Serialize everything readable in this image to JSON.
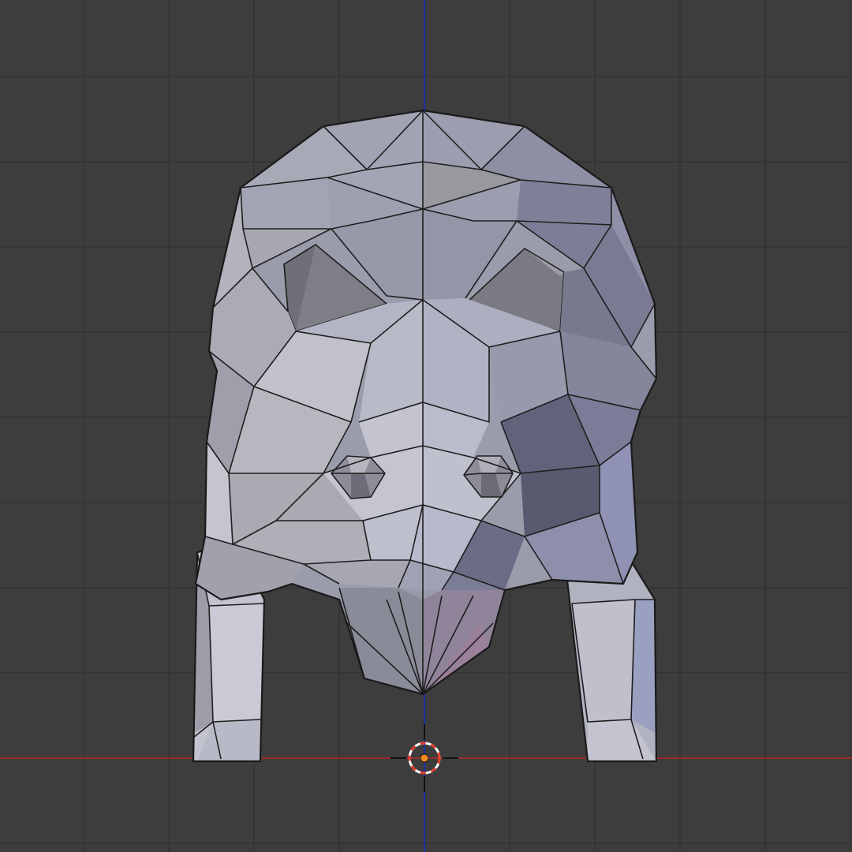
{
  "viewport": {
    "mode": "3d-viewport",
    "view": "front-orthographic",
    "object": "low-poly-pig-mesh",
    "shading": "solid",
    "colors": {
      "background": "#3d3d3d",
      "grid": "#353535",
      "x_axis": "#9a2a2a",
      "z_axis": "#1c2fa8",
      "wire": "#1e1e1e",
      "mesh_base": "#a9aabb",
      "cursor_ring_red": "#e23a2a",
      "cursor_ring_white": "#ffffff",
      "origin": "#ff8a1a"
    },
    "icons": {
      "cursor": "3d-cursor-icon",
      "origin": "object-origin-icon"
    }
  }
}
